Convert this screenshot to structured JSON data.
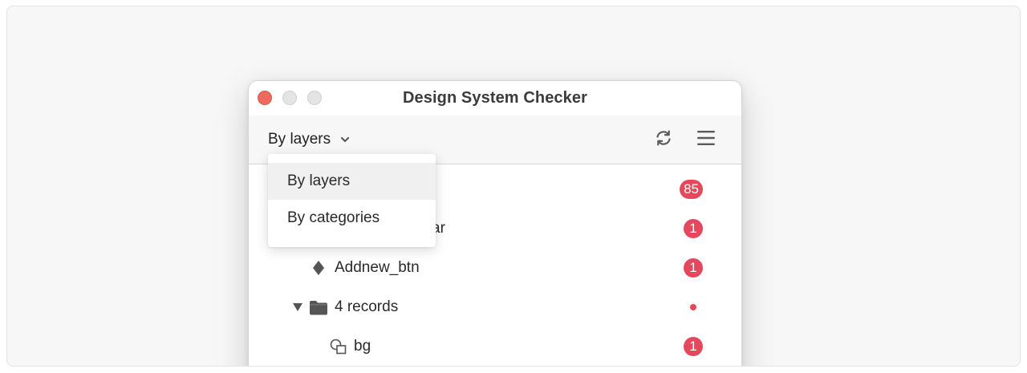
{
  "window": {
    "title": "Design System Checker"
  },
  "toolbar": {
    "view_label": "By layers",
    "refresh_icon": "refresh-icon",
    "menu_icon": "hamburger-menu-icon"
  },
  "dropdown": {
    "options": [
      {
        "label": "By layers",
        "selected": true
      },
      {
        "label": "By categories",
        "selected": false
      }
    ]
  },
  "list": {
    "rows": [
      {
        "label": "",
        "badge": "85",
        "type": "page"
      },
      {
        "label": "ar",
        "badge": "1",
        "type": "group"
      },
      {
        "label": "Addnew_btn",
        "badge": "1",
        "type": "component",
        "icon": "component-diamond-icon"
      },
      {
        "label": "4 records",
        "badge": "",
        "dot": true,
        "type": "folder",
        "icon": "folder-icon",
        "expanded": true
      },
      {
        "label": "bg",
        "badge": "1",
        "type": "shape",
        "icon": "shape-icon"
      }
    ]
  },
  "colors": {
    "badge": "#e5475c",
    "close": "#ee6a5e",
    "toolbar_bg": "#f7f7f7"
  }
}
